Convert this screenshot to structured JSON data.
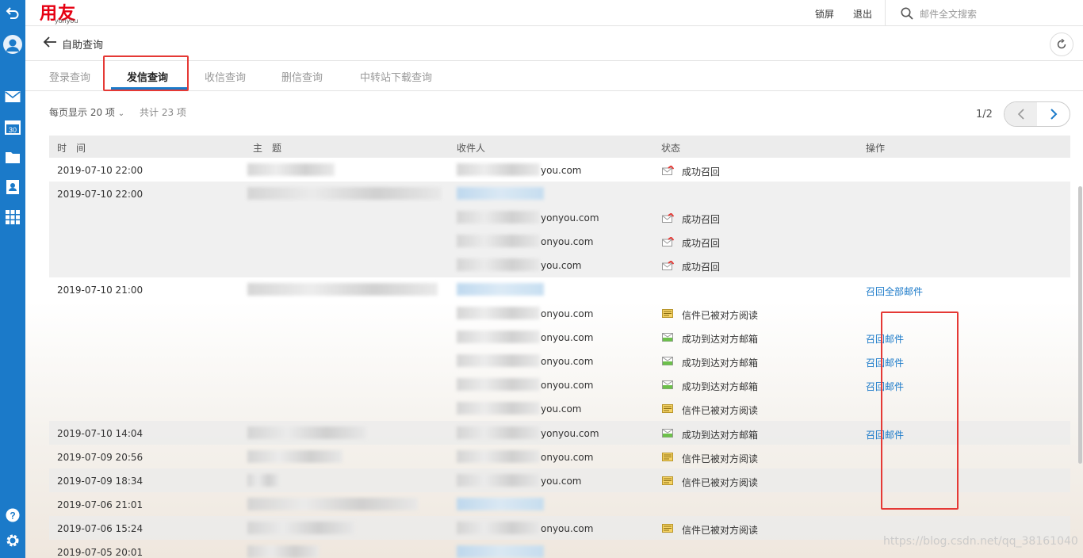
{
  "app": {
    "logo_text": "用友",
    "logo_sub": "yonyou"
  },
  "top": {
    "lock": "锁屏",
    "logout": "退出",
    "search_placeholder": "邮件全文搜索"
  },
  "breadcrumb": {
    "title": "自助查询"
  },
  "tabs": [
    "登录查询",
    "发信查询",
    "收信查询",
    "删信查询",
    "中转站下载查询"
  ],
  "active_tab": "发信查询",
  "list": {
    "per_page": "每页显示 20 项",
    "total": "共计 23 项",
    "page": "1/2",
    "columns": {
      "time": "时　间",
      "subject": "主　题",
      "recipient": "收件人",
      "status": "状态",
      "action": "操作"
    }
  },
  "rows": [
    {
      "time": "2019-07-10 22:00",
      "recipients": [
        {
          "email": "you.com",
          "status": "成功召回",
          "icon": "recall-icon"
        }
      ]
    },
    {
      "time": "2019-07-10 22:00",
      "recipients": [
        {
          "email": "yonyou.com",
          "status": "成功召回",
          "icon": "recall-icon"
        },
        {
          "email": "onyou.com",
          "status": "成功召回",
          "icon": "recall-icon"
        },
        {
          "email": "you.com",
          "status": "成功召回",
          "icon": "recall-icon"
        }
      ]
    },
    {
      "time": "2019-07-10 21:00",
      "group_action": "召回全部邮件",
      "recipients": [
        {
          "email": "onyou.com",
          "status": "信件已被对方阅读",
          "icon": "read-mail-icon"
        },
        {
          "email": "onyou.com",
          "status": "成功到达对方邮箱",
          "icon": "delivered-mail-icon",
          "action": "召回邮件"
        },
        {
          "email": "onyou.com",
          "status": "成功到达对方邮箱",
          "icon": "delivered-mail-icon",
          "action": "召回邮件"
        },
        {
          "email": "onyou.com",
          "status": "成功到达对方邮箱",
          "icon": "delivered-mail-icon",
          "action": "召回邮件"
        },
        {
          "email": "you.com",
          "status": "信件已被对方阅读",
          "icon": "read-mail-icon"
        }
      ]
    },
    {
      "time": "2019-07-10 14:04",
      "recipients": [
        {
          "email": "yonyou.com",
          "status": "成功到达对方邮箱",
          "icon": "delivered-mail-icon",
          "action": "召回邮件"
        }
      ]
    },
    {
      "time": "2019-07-09 20:56",
      "recipients": [
        {
          "email": "onyou.com",
          "status": "信件已被对方阅读",
          "icon": "read-mail-icon"
        }
      ]
    },
    {
      "time": "2019-07-09 18:34",
      "recipients": [
        {
          "email": "you.com",
          "status": "信件已被对方阅读",
          "icon": "read-mail-icon"
        }
      ]
    },
    {
      "time": "2019-07-06 21:01",
      "recipients": []
    },
    {
      "time": "2019-07-06 15:24",
      "recipients": [
        {
          "email": "onyou.com",
          "status": "信件已被对方阅读",
          "icon": "read-mail-icon"
        }
      ]
    },
    {
      "time": "2019-07-05 20:01",
      "recipients": []
    }
  ],
  "watermark": "https://blog.csdn.net/qq_38161040",
  "colors": {
    "sidebar": "#1b7ac9",
    "logo": "#e60012",
    "link": "#1b7ac9",
    "highlight": "#e53935"
  }
}
